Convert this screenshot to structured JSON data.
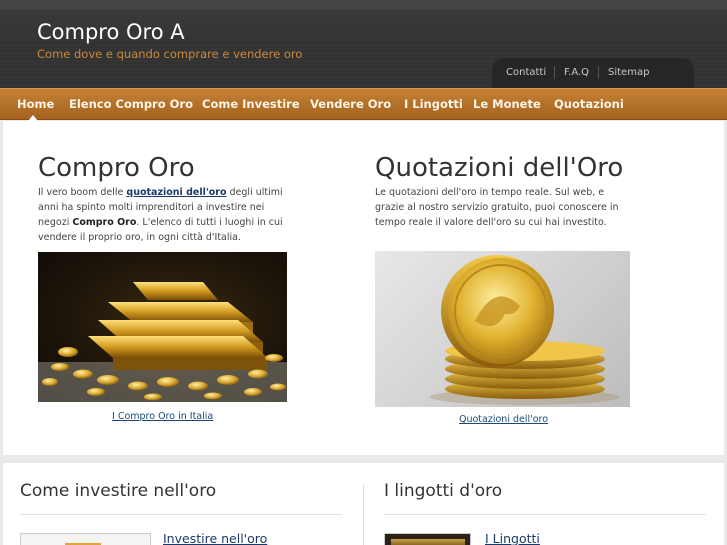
{
  "header": {
    "title": "Compro Oro A",
    "tagline": "Come dove e quando comprare e vendere oro",
    "top_links": [
      "Contatti",
      "F.A.Q",
      "Sitemap"
    ]
  },
  "nav": {
    "items": [
      "Home",
      "Elenco Compro Oro",
      "Come Investire",
      "Vendere Oro",
      "I Lingotti",
      "Le Monete",
      "Quotazioni"
    ],
    "active": "Home"
  },
  "left_col": {
    "title": "Compro Oro",
    "text_part1": "Il vero boom delle ",
    "text_link": "quotazioni dell'oro",
    "text_part2": " degli ultimi anni ha spinto molti imprenditori a investire nei negozi ",
    "text_bold": "Compro Oro",
    "text_part3": ". L'elenco di tutti i luoghi in cui vendere il proprio oro, in ogni città d'Italia.",
    "caption": "I Compro Oro in Italia"
  },
  "right_col": {
    "title": "Quotazioni dell'Oro",
    "text": "Le quotazioni dell'oro in tempo reale. Sul web, e grazie al nostro servizio gratuito, puoi conoscere in tempo reale il valore dell'oro su cui hai investito.",
    "caption": "Quotazioni dell'oro"
  },
  "lower": {
    "left_title": "Come investire nell'oro",
    "left_link": "Investire nell'oro",
    "right_title": "I lingotti d'oro",
    "right_link": "I Lingotti"
  },
  "colors": {
    "nav_bg": "#b8712a",
    "header_bg": "#333333",
    "tagline": "#c9893e",
    "link": "#1a3a6a"
  }
}
